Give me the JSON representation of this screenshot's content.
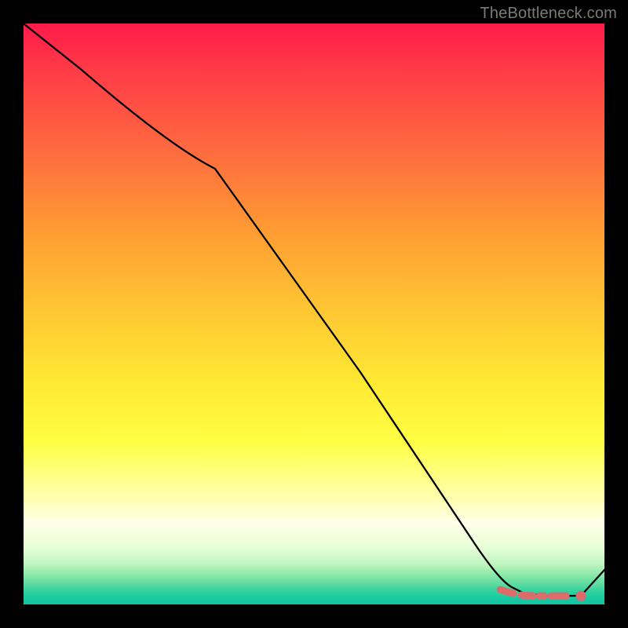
{
  "watermark": "TheBottleneck.com",
  "chart_data": {
    "type": "line",
    "title": "",
    "xlabel": "",
    "ylabel": "",
    "xlim": [
      0,
      100
    ],
    "ylim": [
      0,
      100
    ],
    "grid": false,
    "series": [
      {
        "name": "curve",
        "x": [
          0,
          10,
          25,
          33,
          58,
          78,
          82,
          86,
          90,
          93,
          96,
          100
        ],
        "y": [
          100,
          92,
          79,
          75,
          40,
          10,
          5,
          3,
          2,
          2,
          2,
          6
        ]
      }
    ],
    "markers": [
      {
        "name": "dashed-segment",
        "x_range": [
          82,
          96
        ],
        "y": 2,
        "style": "dashed",
        "color": "#d86b6b"
      },
      {
        "name": "end-dot",
        "x": 96,
        "y": 2,
        "color": "#d86b6b"
      }
    ]
  }
}
